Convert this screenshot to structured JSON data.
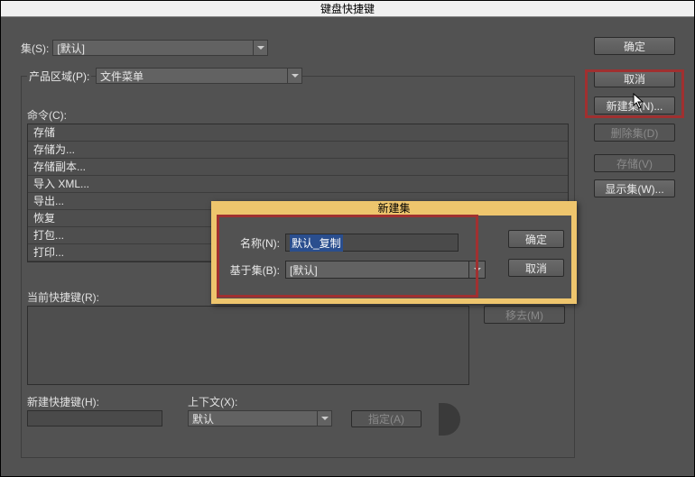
{
  "window": {
    "title": "键盘快捷键"
  },
  "set_row": {
    "label": "集(S):",
    "value": "[默认]"
  },
  "sidebar_buttons": {
    "ok": "确定",
    "cancel": "取消",
    "new_set": "新建集(N)...",
    "delete_set": "删除集(D)",
    "save": "存储(V)",
    "show_set": "显示集(W)..."
  },
  "product_area": {
    "label": "产品区域(P):",
    "value": "文件菜单"
  },
  "command_label": "命令(C):",
  "commands": [
    "存储",
    "存储为...",
    "存储副本...",
    "导入 XML...",
    "导出...",
    "恢复",
    "打包...",
    "打印..."
  ],
  "current_shortcut_label": "当前快捷键(R):",
  "remove_button": "移去(M)",
  "new_shortcut_label": "新建快捷键(H):",
  "context_label": "上下文(X):",
  "context_value": "默认",
  "assign_button": "指定(A)",
  "modal": {
    "title": "新建集",
    "name_label": "名称(N):",
    "name_value": "默认_复制",
    "based_on_label": "基于集(B):",
    "based_on_value": "[默认]",
    "ok": "确定",
    "cancel": "取消"
  }
}
